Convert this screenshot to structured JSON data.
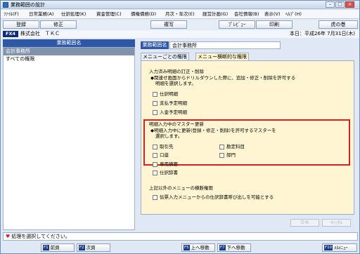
{
  "window": {
    "title": "業務範囲の設計"
  },
  "menu": [
    "ﾌｧｲﾙ(F)",
    "日常業務(A)",
    "仕訳処理(K)",
    "資金管理(C)",
    "債権債務(D)",
    "月次・年次(E)",
    "経営計画(G)",
    "会社情報(B)",
    "表示(V)",
    "ﾍﾙﾌﾟ(H)"
  ],
  "toolbar": {
    "register": "登録",
    "modify": "修正",
    "copy": "複写",
    "preview": "ﾌﾟﾚﾋﾞｭｰ",
    "print": "印刷",
    "right_button": "虎の巻"
  },
  "corp": {
    "fkey": "FX4",
    "company": "株式会社　ＴＫＣ",
    "today": "本日：平成26年 7月31日(木)"
  },
  "left": {
    "header": "業務範囲名",
    "items": [
      "会計事務所",
      "すべての権限"
    ]
  },
  "right": {
    "name_label": "業務範囲名",
    "name_value": "会計事務所",
    "tabs": [
      "メニューごとの権限",
      "メニュー横断的な権限"
    ],
    "sec1": {
      "title": "入力済み明細の訂正・削除",
      "desc": [
        "◆関連せ画面からドリルダウンした際に、追加・修正・削除を許可する",
        "明細を選択します。"
      ],
      "items": [
        "仕訳明細",
        "支払予定明細",
        "入金予定明細"
      ]
    },
    "sec2": {
      "title": "明細入力中のマスター更新",
      "desc": [
        "◆明細入力中に更新(登録・修正・削除)を許可するマスターを",
        "選択します。"
      ],
      "col1": [
        "取引先",
        "口座",
        "専用摘要",
        "仕訳辞書"
      ],
      "col2": [
        "勘定科目",
        "部門"
      ]
    },
    "sec3": {
      "title": "上記以外のメニューの横断権限",
      "items": [
        "伝票入力メニューからの仕訳辞書呼び出しを可能とする"
      ]
    },
    "ok": "ＯＫ",
    "cancel": "ｷｬﾝｾﾙ"
  },
  "status": "処理を選択してください。",
  "fkeys": [
    {
      "key": "F1",
      "label": "前頁"
    },
    {
      "key": "F2",
      "label": "次頁"
    },
    {
      "key": "F5",
      "label": "上へ移動"
    },
    {
      "key": "F7",
      "label": "下へ移動"
    },
    {
      "key": "F10",
      "label": "ﾒﾙﾒﾆｭｰ"
    }
  ]
}
